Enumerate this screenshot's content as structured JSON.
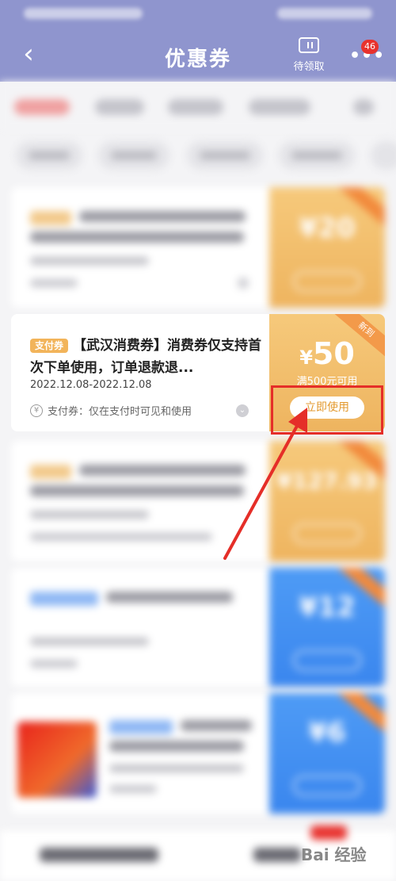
{
  "header": {
    "back_label": "‹",
    "title": "优惠券",
    "pending_label": "待领取",
    "more_label": "•••",
    "badge_count": "46",
    "background": "#8f95ce"
  },
  "featured_coupon": {
    "tag": "支付券",
    "title": "【武汉消费券】消费券仅支持首次下单使用，订单退款退...",
    "date_range": "2022.12.08-2022.12.08",
    "note_icon": "¥",
    "note": "支付券：仅在支付时可见和使用",
    "chevron": "⌄",
    "currency": "¥",
    "amount": "50",
    "condition": "满500元可用",
    "use_button": "立即使用",
    "ribbon": "新到",
    "accent": "#f6c97b"
  },
  "blurred_amounts": {
    "card1": "¥20",
    "card3": "¥127.93",
    "card4": "¥12",
    "card5": "¥6"
  },
  "watermark": "Bai 经验",
  "colors": {
    "orange": "#eeb45f",
    "blue": "#3a86ee",
    "highlight": "#e52e28"
  }
}
